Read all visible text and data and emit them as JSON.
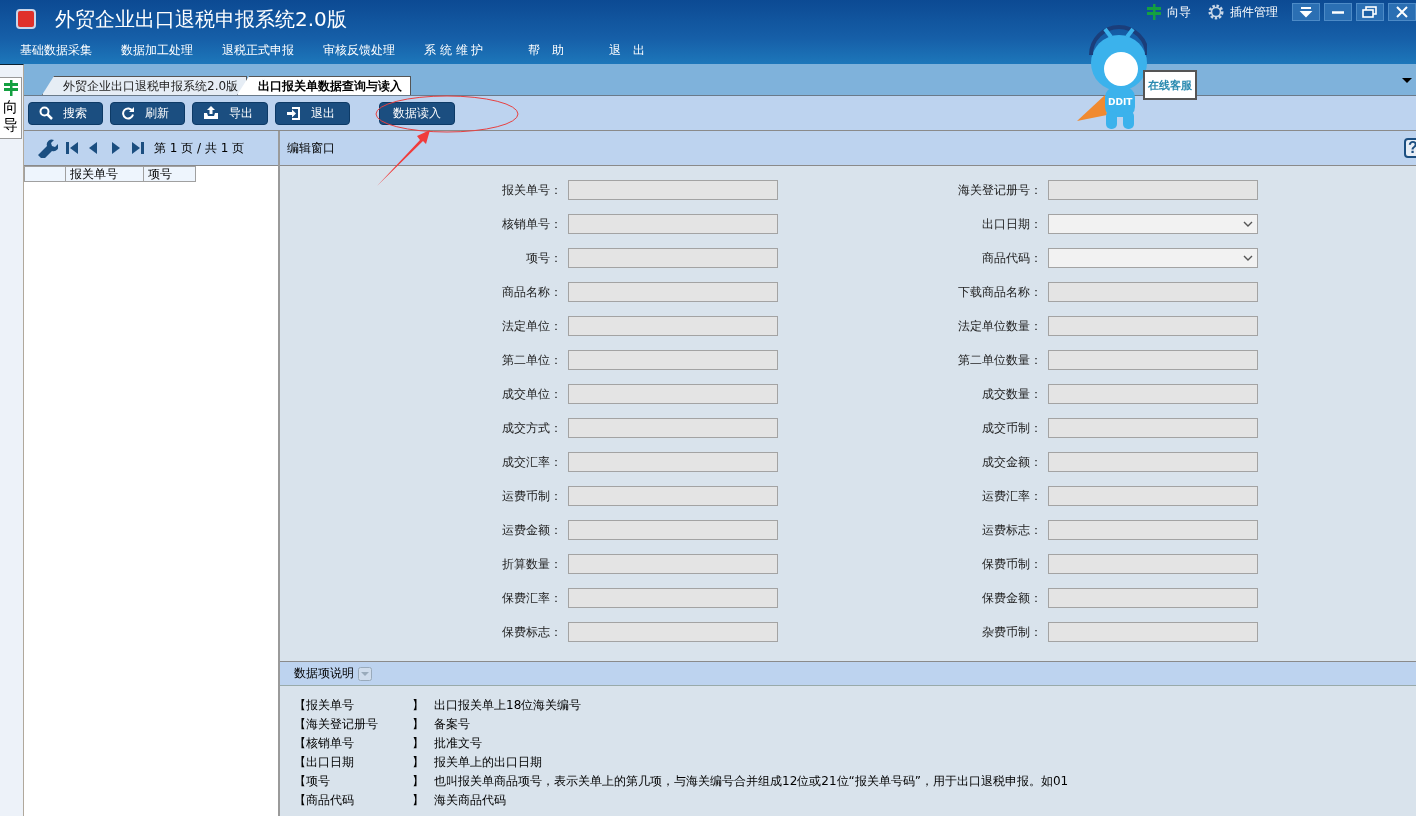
{
  "window": {
    "title": "外贸企业出口退税申报系统2.0版",
    "top_links": [
      {
        "label": "向导",
        "kind": "guide"
      },
      {
        "label": "插件管理",
        "kind": "plugins"
      }
    ]
  },
  "menu": [
    "基础数据采集",
    "数据加工处理",
    "退税正式申报",
    "审核反馈处理",
    "系 统 维 护",
    "帮　助",
    "退　出"
  ],
  "helper": {
    "sign": "在线客服",
    "badge": "DDIT"
  },
  "side_tab": {
    "label": "向导"
  },
  "tabs": [
    {
      "label": "外贸企业出口退税申报系统2.0版",
      "selected": false
    },
    {
      "label": "出口报关单数据查询与读入",
      "selected": true
    }
  ],
  "toolbar": [
    {
      "label": "搜索",
      "kind": "search"
    },
    {
      "label": "刷新",
      "kind": "refresh"
    },
    {
      "label": "导出",
      "kind": "export"
    },
    {
      "label": "退出",
      "kind": "exit"
    },
    {
      "label": "数据读入",
      "kind": "plain"
    }
  ],
  "list": {
    "pager": [
      "第",
      "1",
      "页",
      "/",
      "共",
      "1",
      "页"
    ],
    "columns": [
      "",
      "报关单号",
      "项号"
    ]
  },
  "form": {
    "title": "编辑窗口",
    "help": "?",
    "rows": [
      [
        {
          "label": "报关单号：",
          "kind": "text"
        },
        {
          "label": "海关登记册号：",
          "kind": "text"
        }
      ],
      [
        {
          "label": "核销单号：",
          "kind": "text"
        },
        {
          "label": "出口日期：",
          "kind": "select"
        }
      ],
      [
        {
          "label": "项号：",
          "kind": "text"
        },
        {
          "label": "商品代码：",
          "kind": "select"
        }
      ],
      [
        {
          "label": "商品名称：",
          "kind": "text"
        },
        {
          "label": "下载商品名称：",
          "kind": "text"
        }
      ],
      [
        {
          "label": "法定单位：",
          "kind": "text"
        },
        {
          "label": "法定单位数量：",
          "kind": "text"
        }
      ],
      [
        {
          "label": "第二单位：",
          "kind": "text"
        },
        {
          "label": "第二单位数量：",
          "kind": "text"
        }
      ],
      [
        {
          "label": "成交单位：",
          "kind": "text"
        },
        {
          "label": "成交数量：",
          "kind": "text"
        }
      ],
      [
        {
          "label": "成交方式：",
          "kind": "text"
        },
        {
          "label": "成交币制：",
          "kind": "text"
        }
      ],
      [
        {
          "label": "成交汇率：",
          "kind": "text"
        },
        {
          "label": "成交金额：",
          "kind": "text"
        }
      ],
      [
        {
          "label": "运费币制：",
          "kind": "text"
        },
        {
          "label": "运费汇率：",
          "kind": "text"
        }
      ],
      [
        {
          "label": "运费金额：",
          "kind": "text"
        },
        {
          "label": "运费标志：",
          "kind": "text"
        }
      ],
      [
        {
          "label": "折算数量：",
          "kind": "text"
        },
        {
          "label": "保费币制：",
          "kind": "text"
        }
      ],
      [
        {
          "label": "保费汇率：",
          "kind": "text"
        },
        {
          "label": "保费金额：",
          "kind": "text"
        }
      ],
      [
        {
          "label": "保费标志：",
          "kind": "text"
        },
        {
          "label": "杂费币制：",
          "kind": "text"
        }
      ]
    ]
  },
  "description": {
    "title": "数据项说明",
    "items": [
      {
        "term": "【报关单号",
        "close": "】",
        "text": "出口报关单上18位海关编号"
      },
      {
        "term": "【海关登记册号",
        "close": "】",
        "text": "备案号"
      },
      {
        "term": "【核销单号",
        "close": "】",
        "text": "批准文号"
      },
      {
        "term": "【出口日期",
        "close": "】",
        "text": "报关单上的出口日期"
      },
      {
        "term": "【项号",
        "close": "】",
        "text": "也叫报关单商品项号，表示关单上的第几项，与海关编号合并组成12位或21位“报关单号码”，用于出口退税申报。如01"
      },
      {
        "term": "【商品代码",
        "close": "】",
        "text": "海关商品代码"
      }
    ]
  }
}
